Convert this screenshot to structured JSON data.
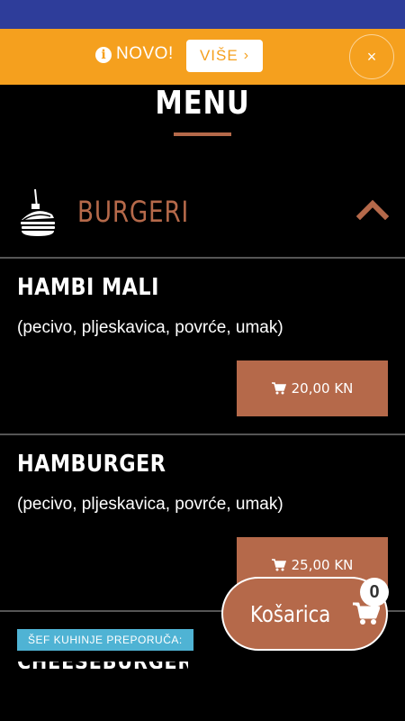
{
  "colors": {
    "accent": "#b5694a",
    "promo_bg": "#f5a01e",
    "status_bar": "#2e3d9a",
    "badge": "#4fb3d4"
  },
  "promo": {
    "info_icon": "info-circle-icon",
    "text": "NOVO!",
    "button_label": "VIŠE",
    "button_chevron": "›",
    "close_label": "×"
  },
  "menu": {
    "title": "MENU"
  },
  "category": {
    "icon": "burger-icon",
    "name": "BURGERI",
    "toggle_icon": "chevron-up-icon"
  },
  "items": [
    {
      "name": "HAMBI MALI",
      "description": "(pecivo, pljeskavica, povrće, umak)",
      "price": "20,00 KN"
    },
    {
      "name": "HAMBURGER",
      "description": "(pecivo, pljeskavica, povrće, umak)",
      "price": "25,00 KN"
    }
  ],
  "recommendation": {
    "badge": "ŠEF KUHINJE PREPORUČA:",
    "next_item_name": "CHEESEBURGER"
  },
  "cart": {
    "label": "Košarica",
    "icon": "cart-icon",
    "count": "0"
  }
}
